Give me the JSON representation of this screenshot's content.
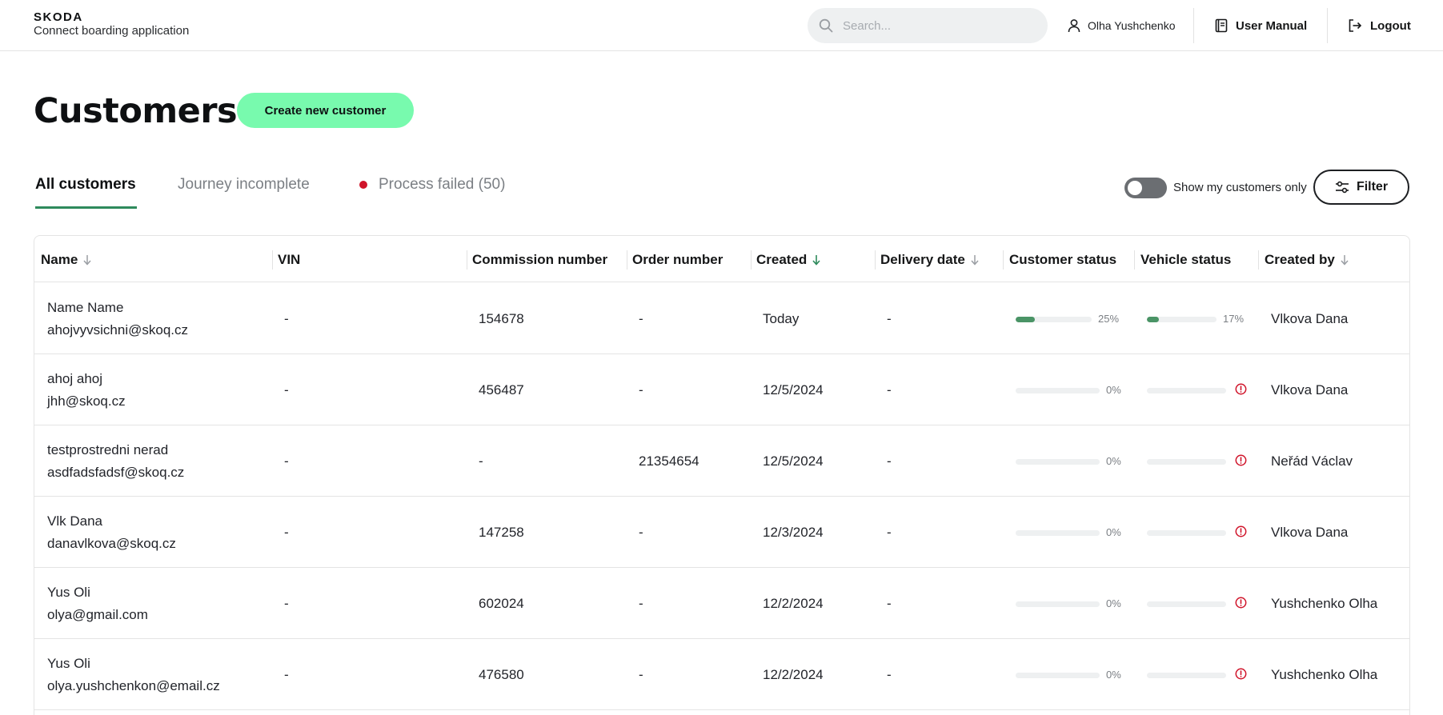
{
  "header": {
    "logo": "SKODA",
    "app_name": "Connect boarding application",
    "search_placeholder": "Search...",
    "user_name": "Olha Yushchenko",
    "user_manual": "User Manual",
    "logout": "Logout"
  },
  "page": {
    "title": "Customers",
    "create_button": "Create new customer"
  },
  "tabs": [
    {
      "label": "All customers",
      "active": true
    },
    {
      "label": "Journey incomplete",
      "active": false
    },
    {
      "label": "Process failed (50)",
      "active": false
    }
  ],
  "controls": {
    "toggle_label": "Show my customers only",
    "toggle_on": false,
    "filter_label": "Filter"
  },
  "colors": {
    "accent_green": "#78faae",
    "tab_underline": "#2e8a5c",
    "progress_fill": "#4a9466",
    "alert_red": "#d0142a"
  },
  "table": {
    "columns": [
      {
        "label": "Name",
        "sort": "down"
      },
      {
        "label": "VIN",
        "sort": null
      },
      {
        "label": "Commission number",
        "sort": null
      },
      {
        "label": "Order number",
        "sort": null
      },
      {
        "label": "Created",
        "sort": "active-down"
      },
      {
        "label": "Delivery date",
        "sort": "down"
      },
      {
        "label": "Customer status",
        "sort": null
      },
      {
        "label": "Vehicle status",
        "sort": null
      },
      {
        "label": "Created by",
        "sort": "down"
      }
    ],
    "rows": [
      {
        "name": "Name Name",
        "email": "ahojvyvsichni@skoq.cz",
        "vin": "-",
        "commission": "154678",
        "order": "-",
        "created": "Today",
        "delivery": "-",
        "customer_status": 25,
        "customer_status_label": "25%",
        "vehicle_status": 17,
        "vehicle_status_label": "17%",
        "vehicle_alert": false,
        "created_by": "Vlkova Dana"
      },
      {
        "name": "ahoj ahoj",
        "email": "jhh@skoq.cz",
        "vin": "-",
        "commission": "456487",
        "order": "-",
        "created": "12/5/2024",
        "delivery": "-",
        "customer_status": 0,
        "customer_status_label": "0%",
        "vehicle_status": 0,
        "vehicle_status_label": "",
        "vehicle_alert": true,
        "created_by": "Vlkova Dana"
      },
      {
        "name": "testprostredni nerad",
        "email": "asdfadsfadsf@skoq.cz",
        "vin": "-",
        "commission": "-",
        "order": "21354654",
        "created": "12/5/2024",
        "delivery": "-",
        "customer_status": 0,
        "customer_status_label": "0%",
        "vehicle_status": 0,
        "vehicle_status_label": "",
        "vehicle_alert": true,
        "created_by": "Neřád Václav"
      },
      {
        "name": "Vlk Dana",
        "email": "danavlkova@skoq.cz",
        "vin": "-",
        "commission": "147258",
        "order": "-",
        "created": "12/3/2024",
        "delivery": "-",
        "customer_status": 0,
        "customer_status_label": "0%",
        "vehicle_status": 0,
        "vehicle_status_label": "",
        "vehicle_alert": true,
        "created_by": "Vlkova Dana"
      },
      {
        "name": "Yus Oli",
        "email": "olya@gmail.com",
        "vin": "-",
        "commission": "602024",
        "order": "-",
        "created": "12/2/2024",
        "delivery": "-",
        "customer_status": 0,
        "customer_status_label": "0%",
        "vehicle_status": 0,
        "vehicle_status_label": "",
        "vehicle_alert": true,
        "created_by": "Yushchenko Olha"
      },
      {
        "name": "Yus Oli",
        "email": "olya.yushchenkon@email.cz",
        "vin": "-",
        "commission": "476580",
        "order": "-",
        "created": "12/2/2024",
        "delivery": "-",
        "customer_status": 0,
        "customer_status_label": "0%",
        "vehicle_status": 0,
        "vehicle_status_label": "",
        "vehicle_alert": true,
        "created_by": "Yushchenko Olha"
      }
    ]
  }
}
